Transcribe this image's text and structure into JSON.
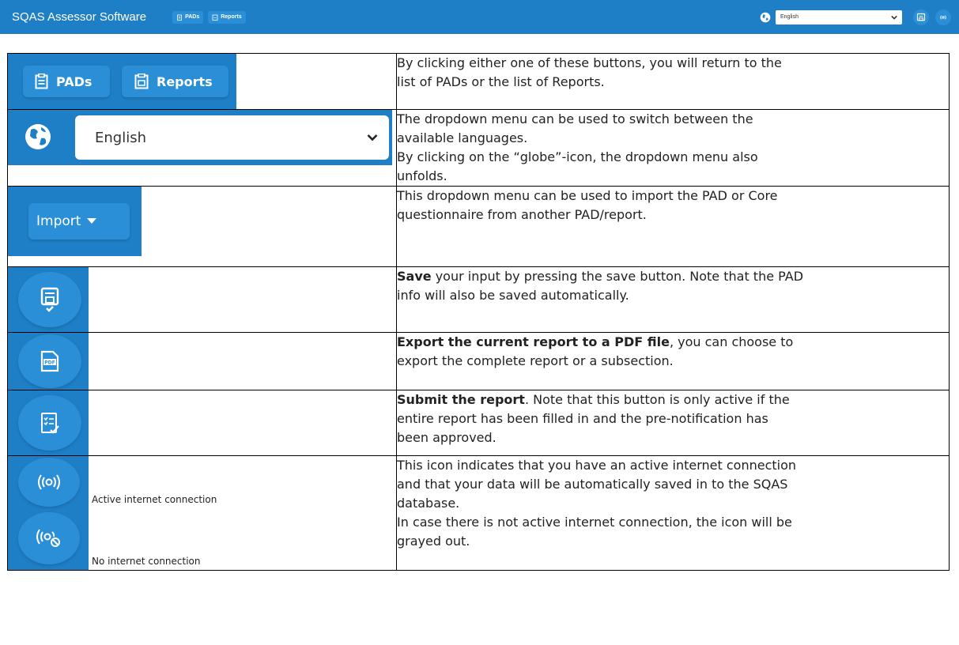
{
  "app": {
    "title": "SQAS Assessor Software",
    "nav": {
      "pads_label": "PADs",
      "reports_label": "Reports"
    },
    "language_select": {
      "value": "English"
    }
  },
  "rows": [
    {
      "buttons": {
        "pads": "PADs",
        "reports": "Reports"
      },
      "description": [
        "By clicking either one of these buttons, you will return to the",
        "list of PADs or the list of Reports."
      ]
    },
    {
      "select_value": "English",
      "description": [
        "The dropdown menu can be used to switch between the",
        "available languages.",
        "By clicking on the “globe”-icon, the dropdown menu also",
        "unfolds."
      ]
    },
    {
      "button_label": "Import",
      "description": [
        "This dropdown menu can be used to import the PAD or Core",
        "questionnaire from another PAD/report."
      ]
    },
    {
      "bold": "Save",
      "text_1": " your input by pressing the save button. Note that the PAD",
      "text_2": "info will also be saved automatically."
    },
    {
      "bold": "Export the current report to a PDF file",
      "text_1": ", you can choose to",
      "text_2": "export the complete report or a subsection."
    },
    {
      "bold": "Submit the report",
      "text_1": ". Note that this button is only active if the",
      "text_2": "entire report has been filled in and the pre-notification has",
      "text_3": "been approved."
    },
    {
      "active_caption": "Active internet connection",
      "inactive_caption": "No internet connection",
      "description": [
        "This icon indicates that you have an active internet connection",
        "and that your data will be automatically saved in to the SQAS",
        "database.",
        "In case there is not active internet connection, the icon will be",
        "grayed out."
      ]
    }
  ],
  "colors": {
    "bar": "#1f7fc6",
    "button": "#2a8fd6"
  }
}
